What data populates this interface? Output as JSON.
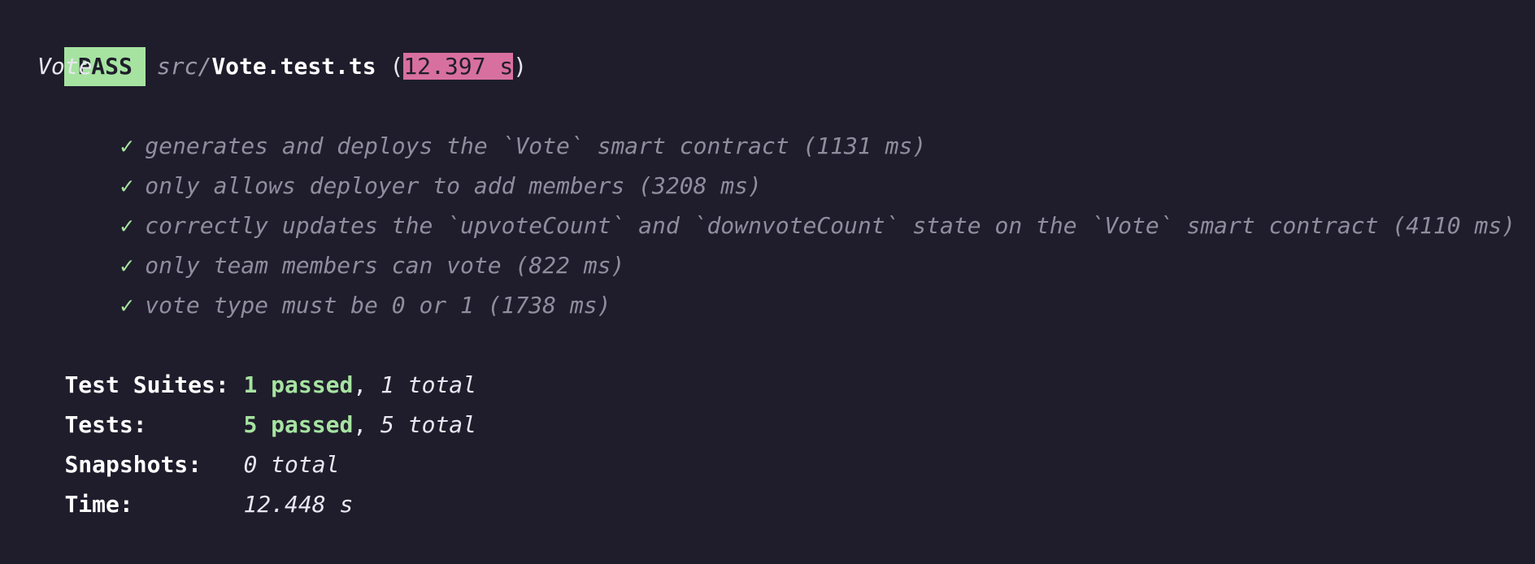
{
  "header": {
    "status_badge": "PASS",
    "path_dir": "src/",
    "file_name": "Vote.test.ts",
    "open_paren": " (",
    "duration": "12.397 s",
    "close_paren": ")"
  },
  "suite": {
    "name": "Vote",
    "tests": [
      {
        "check": "✓",
        "text": "generates and deploys the `Vote` smart contract (1131 ms)"
      },
      {
        "check": "✓",
        "text": "only allows deployer to add members (3208 ms)"
      },
      {
        "check": "✓",
        "text": "correctly updates the `upvoteCount` and `downvoteCount` state on the `Vote` smart contract (4110 ms)"
      },
      {
        "check": "✓",
        "text": "only team members can vote (822 ms)"
      },
      {
        "check": "✓",
        "text": "vote type must be 0 or 1 (1738 ms)"
      }
    ]
  },
  "summary": {
    "suites_label": "Test Suites:",
    "suites_passed": "1 passed",
    "suites_sep": ", ",
    "suites_total": "1 total",
    "tests_label": "Tests:",
    "tests_passed": "5 passed",
    "tests_sep": ", ",
    "tests_total": "5 total",
    "snapshots_label": "Snapshots:",
    "snapshots_total": "0 total",
    "time_label": "Time:",
    "time_value": "12.448 s"
  },
  "colors": {
    "background": "#1f1d2b",
    "pass_badge": "#a6e3a1",
    "duration_highlight": "#d8709f",
    "check_green": "#a6e3a1",
    "dim_text": "#8f8d9e"
  }
}
